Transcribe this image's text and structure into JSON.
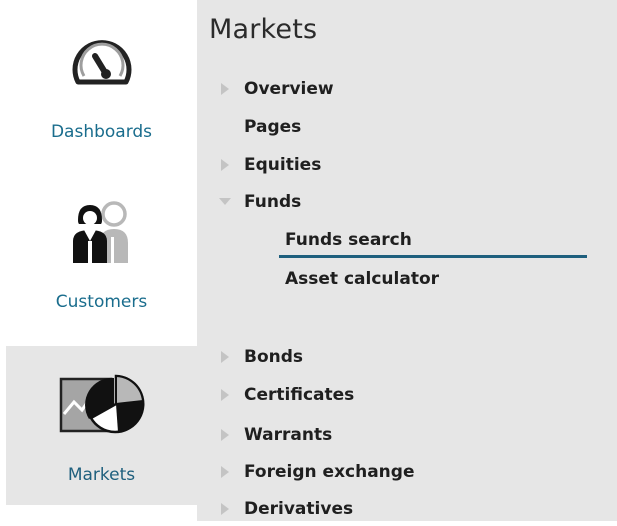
{
  "sidebar": {
    "items": [
      {
        "label": "Dashboards",
        "icon": "speedometer-icon",
        "active": false
      },
      {
        "label": "Customers",
        "icon": "people-icon",
        "active": false
      },
      {
        "label": "Markets",
        "icon": "chart-pie-icon",
        "active": true
      }
    ]
  },
  "menu": {
    "title": "Markets",
    "items": [
      {
        "label": "Overview",
        "arrow": "right"
      },
      {
        "label": "Pages",
        "arrow": "none"
      },
      {
        "label": "Equities",
        "arrow": "right"
      },
      {
        "label": "Funds",
        "arrow": "down"
      },
      {
        "label": "Funds search",
        "arrow": "none",
        "sub": true,
        "selected": true
      },
      {
        "label": "Asset calculator",
        "arrow": "none",
        "sub": true
      },
      {
        "label": "Bonds",
        "arrow": "right"
      },
      {
        "label": "Certificates",
        "arrow": "right"
      },
      {
        "label": "Warrants",
        "arrow": "right"
      },
      {
        "label": "Foreign exchange",
        "arrow": "right"
      },
      {
        "label": "Derivatives",
        "arrow": "right"
      }
    ]
  },
  "colors": {
    "accent": "#1e5f7d",
    "panel_bg": "#e6e6e6",
    "arrow": "#c4c4c4"
  }
}
